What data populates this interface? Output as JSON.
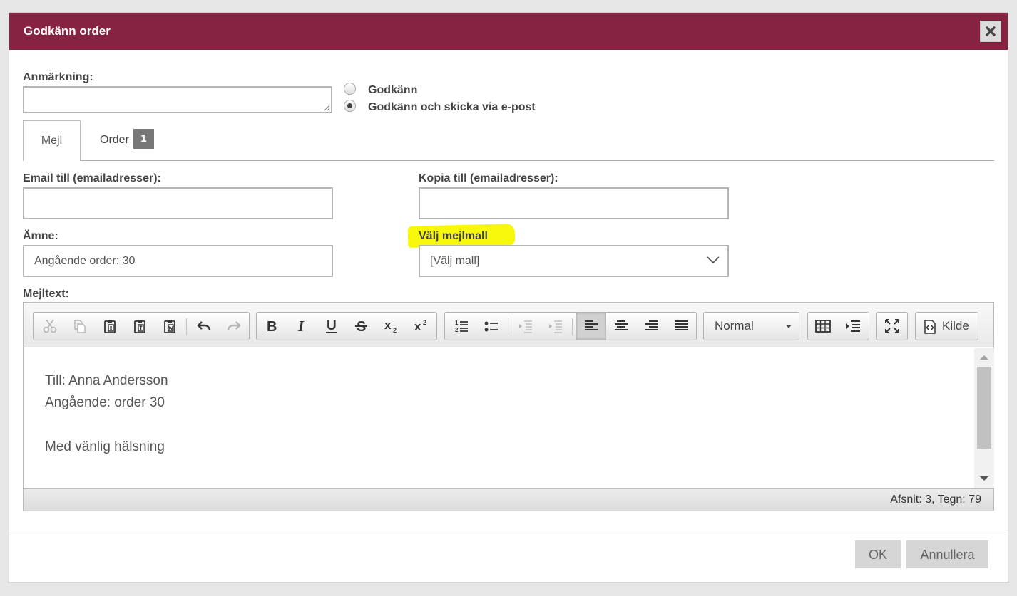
{
  "dialog": {
    "title": "Godkänn order",
    "close_icon": "close-icon"
  },
  "remark": {
    "label": "Anmärkning:",
    "value": ""
  },
  "approval_options": [
    {
      "label": "Godkänn",
      "checked": false
    },
    {
      "label": "Godkänn och skicka via e-post",
      "checked": true
    }
  ],
  "tabs": [
    {
      "label": "Mejl",
      "active": true
    },
    {
      "label": "Order",
      "badge": "1",
      "active": false
    }
  ],
  "email": {
    "to_label": "Email till (emailadresser):",
    "to_value": "",
    "cc_label": "Kopia till (emailadresser):",
    "cc_value": "",
    "subject_label": "Ämne:",
    "subject_value": "Angående order: 30",
    "template_label": "Välj mejlmall",
    "template_selected": "[Välj mall]",
    "body_label": "Mejltext:"
  },
  "editor": {
    "format_value": "Normal",
    "source_label": "Kilde",
    "toolbar_icons": [
      "cut-icon",
      "copy-icon",
      "paste-icon",
      "paste-text-icon",
      "paste-word-icon",
      "undo-icon",
      "redo-icon",
      "bold-icon",
      "italic-icon",
      "underline-icon",
      "strikethrough-icon",
      "subscript-icon",
      "superscript-icon",
      "numbered-list-icon",
      "bulleted-list-icon",
      "decrease-indent-icon",
      "increase-indent-icon",
      "align-left-icon",
      "align-center-icon",
      "align-right-icon",
      "justify-icon",
      "table-icon",
      "indent-block-icon",
      "maximize-icon",
      "source-icon"
    ],
    "content_lines": [
      "Till: Anna Andersson",
      "Angående: order 30",
      "",
      "Med vänlig hälsning"
    ],
    "status": "Afsnit: 3, Tegn: 79"
  },
  "footer": {
    "ok_label": "OK",
    "cancel_label": "Annullera"
  },
  "colors": {
    "titlebar": "#852341",
    "highlight": "#f7f70a"
  }
}
